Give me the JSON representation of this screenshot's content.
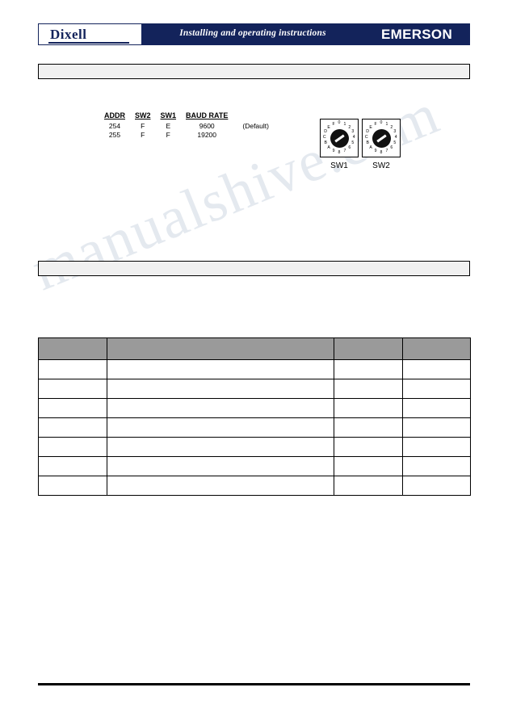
{
  "document": {
    "header": {
      "brand_left": "Dixell",
      "title": "Installing and operating instructions",
      "brand_right": "EMERSON"
    },
    "section_bars": [
      {
        "label": ""
      },
      {
        "label": ""
      }
    ],
    "switch_table": {
      "headers": [
        "ADDR",
        "SW2",
        "SW1",
        "BAUD RATE"
      ],
      "rows": [
        {
          "addr": "254",
          "sw2": "F",
          "sw1": "E",
          "baud": "9600",
          "note": "(Default)"
        },
        {
          "addr": "255",
          "sw2": "F",
          "sw1": "F",
          "baud": "19200",
          "note": ""
        }
      ]
    },
    "rotary_switches": [
      {
        "label": "SW1",
        "ticks": [
          "0",
          "1",
          "2",
          "3",
          "4",
          "5",
          "6",
          "7",
          "8",
          "9",
          "A",
          "B",
          "C",
          "D",
          "E",
          "F"
        ]
      },
      {
        "label": "SW2",
        "ticks": [
          "0",
          "1",
          "2",
          "3",
          "4",
          "5",
          "6",
          "7",
          "8",
          "9",
          "A",
          "B",
          "C",
          "D",
          "E",
          "F"
        ]
      }
    ],
    "param_table": {
      "headers": [
        "",
        "",
        "",
        ""
      ],
      "rows": [
        [
          "",
          "",
          "",
          ""
        ],
        [
          "",
          "",
          "",
          ""
        ],
        [
          "",
          "",
          "",
          ""
        ],
        [
          "",
          "",
          "",
          ""
        ],
        [
          "",
          "",
          "",
          ""
        ],
        [
          "",
          "",
          "",
          ""
        ],
        [
          "",
          "",
          "",
          ""
        ]
      ]
    },
    "watermark": "manualshive.com"
  }
}
